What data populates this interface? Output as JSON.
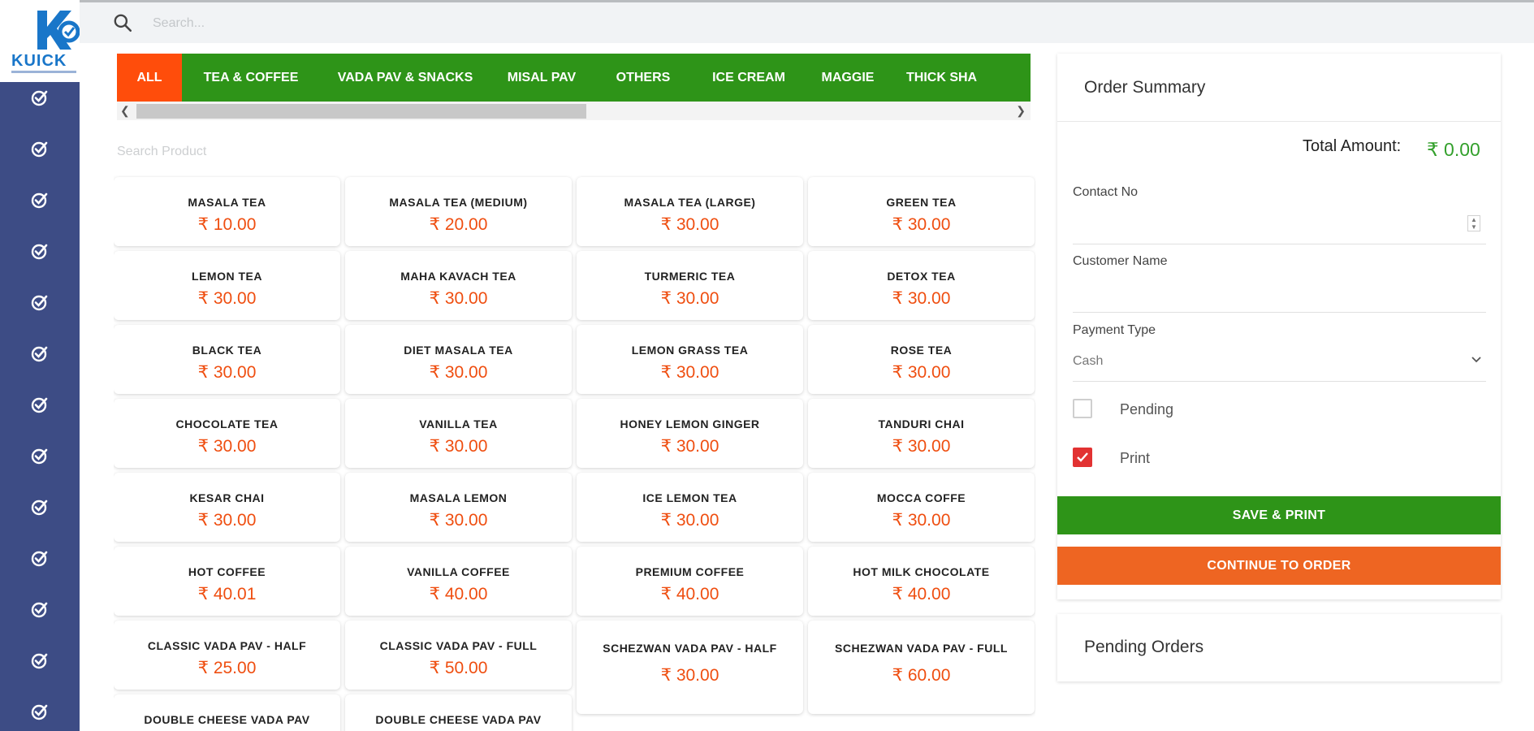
{
  "brand": {
    "name": "KUICK",
    "primary": "#1976c9",
    "sidebar_bg": "#3d4c85"
  },
  "search": {
    "placeholder": "Search..."
  },
  "sidebar": {
    "items": [
      {
        "icon": "check-circle-icon"
      },
      {
        "icon": "check-circle-icon"
      },
      {
        "icon": "check-circle-icon"
      },
      {
        "icon": "check-circle-icon"
      },
      {
        "icon": "check-circle-icon"
      },
      {
        "icon": "check-circle-icon"
      },
      {
        "icon": "check-circle-icon"
      },
      {
        "icon": "check-circle-icon"
      },
      {
        "icon": "check-circle-icon"
      },
      {
        "icon": "check-circle-icon"
      },
      {
        "icon": "check-circle-icon"
      },
      {
        "icon": "check-circle-icon"
      },
      {
        "icon": "check-circle-icon"
      }
    ]
  },
  "categories": {
    "tabs": [
      {
        "label": "ALL",
        "active": true
      },
      {
        "label": "TEA & COFFEE",
        "active": false
      },
      {
        "label": "VADA PAV & SNACKS",
        "active": false
      },
      {
        "label": "MISAL PAV",
        "active": false
      },
      {
        "label": "OTHERS",
        "active": false
      },
      {
        "label": "ICE CREAM",
        "active": false
      },
      {
        "label": "MAGGIE",
        "active": false
      },
      {
        "label": "THICK SHA",
        "active": false
      }
    ],
    "colors": {
      "bar": "#2e9418",
      "active": "#ff4d0b"
    }
  },
  "product_search": {
    "placeholder": "Search Product"
  },
  "products": [
    {
      "name": "MASALA TEA",
      "price": "₹ 10.00"
    },
    {
      "name": "MASALA TEA (MEDIUM)",
      "price": "₹ 20.00"
    },
    {
      "name": "MASALA TEA (LARGE)",
      "price": "₹ 30.00"
    },
    {
      "name": "GREEN TEA",
      "price": "₹ 30.00"
    },
    {
      "name": "LEMON TEA",
      "price": "₹ 30.00"
    },
    {
      "name": "MAHA KAVACH TEA",
      "price": "₹ 30.00"
    },
    {
      "name": "TURMERIC TEA",
      "price": "₹ 30.00"
    },
    {
      "name": "DETOX TEA",
      "price": "₹ 30.00"
    },
    {
      "name": "BLACK TEA",
      "price": "₹ 30.00"
    },
    {
      "name": "DIET MASALA TEA",
      "price": "₹ 30.00"
    },
    {
      "name": "LEMON GRASS TEA",
      "price": "₹ 30.00"
    },
    {
      "name": "ROSE TEA",
      "price": "₹ 30.00"
    },
    {
      "name": "CHOCOLATE TEA",
      "price": "₹ 30.00"
    },
    {
      "name": "VANILLA TEA",
      "price": "₹ 30.00"
    },
    {
      "name": "HONEY LEMON GINGER",
      "price": "₹ 30.00"
    },
    {
      "name": "TANDURI CHAI",
      "price": "₹ 30.00"
    },
    {
      "name": "KESAR CHAI",
      "price": "₹ 30.00"
    },
    {
      "name": "MASALA LEMON",
      "price": "₹ 30.00"
    },
    {
      "name": "ICE LEMON TEA",
      "price": "₹ 30.00"
    },
    {
      "name": "MOCCA COFFE",
      "price": "₹ 30.00"
    },
    {
      "name": "HOT COFFEE",
      "price": "₹ 40.01"
    },
    {
      "name": "VANILLA COFFEE",
      "price": "₹ 40.00"
    },
    {
      "name": "PREMIUM COFFEE",
      "price": "₹ 40.00"
    },
    {
      "name": "HOT MILK CHOCOLATE",
      "price": "₹ 40.00"
    },
    {
      "name": "CLASSIC VADA PAV - HALF",
      "price": "₹ 25.00"
    },
    {
      "name": "CLASSIC VADA PAV - FULL",
      "price": "₹ 50.00"
    },
    {
      "name": "SCHEZWAN VADA PAV - HALF",
      "price": "₹ 30.00"
    },
    {
      "name": "SCHEZWAN VADA PAV - FULL",
      "price": "₹ 60.00"
    },
    {
      "name": "DOUBLE CHEESE VADA PAV",
      "price": ""
    },
    {
      "name": "DOUBLE CHEESE VADA PAV",
      "price": ""
    }
  ],
  "order_summary": {
    "title": "Order Summary",
    "total_label": "Total Amount:",
    "total_value": "₹ 0.00",
    "contact_label": "Contact No",
    "contact_value": "",
    "customer_label": "Customer Name",
    "customer_value": "",
    "payment_label": "Payment Type",
    "payment_value": "Cash",
    "pending_label": "Pending",
    "pending_checked": false,
    "print_label": "Print",
    "print_checked": true,
    "save_label": "SAVE & PRINT",
    "continue_label": "CONTINUE TO ORDER"
  },
  "pending_orders": {
    "title": "Pending Orders"
  }
}
